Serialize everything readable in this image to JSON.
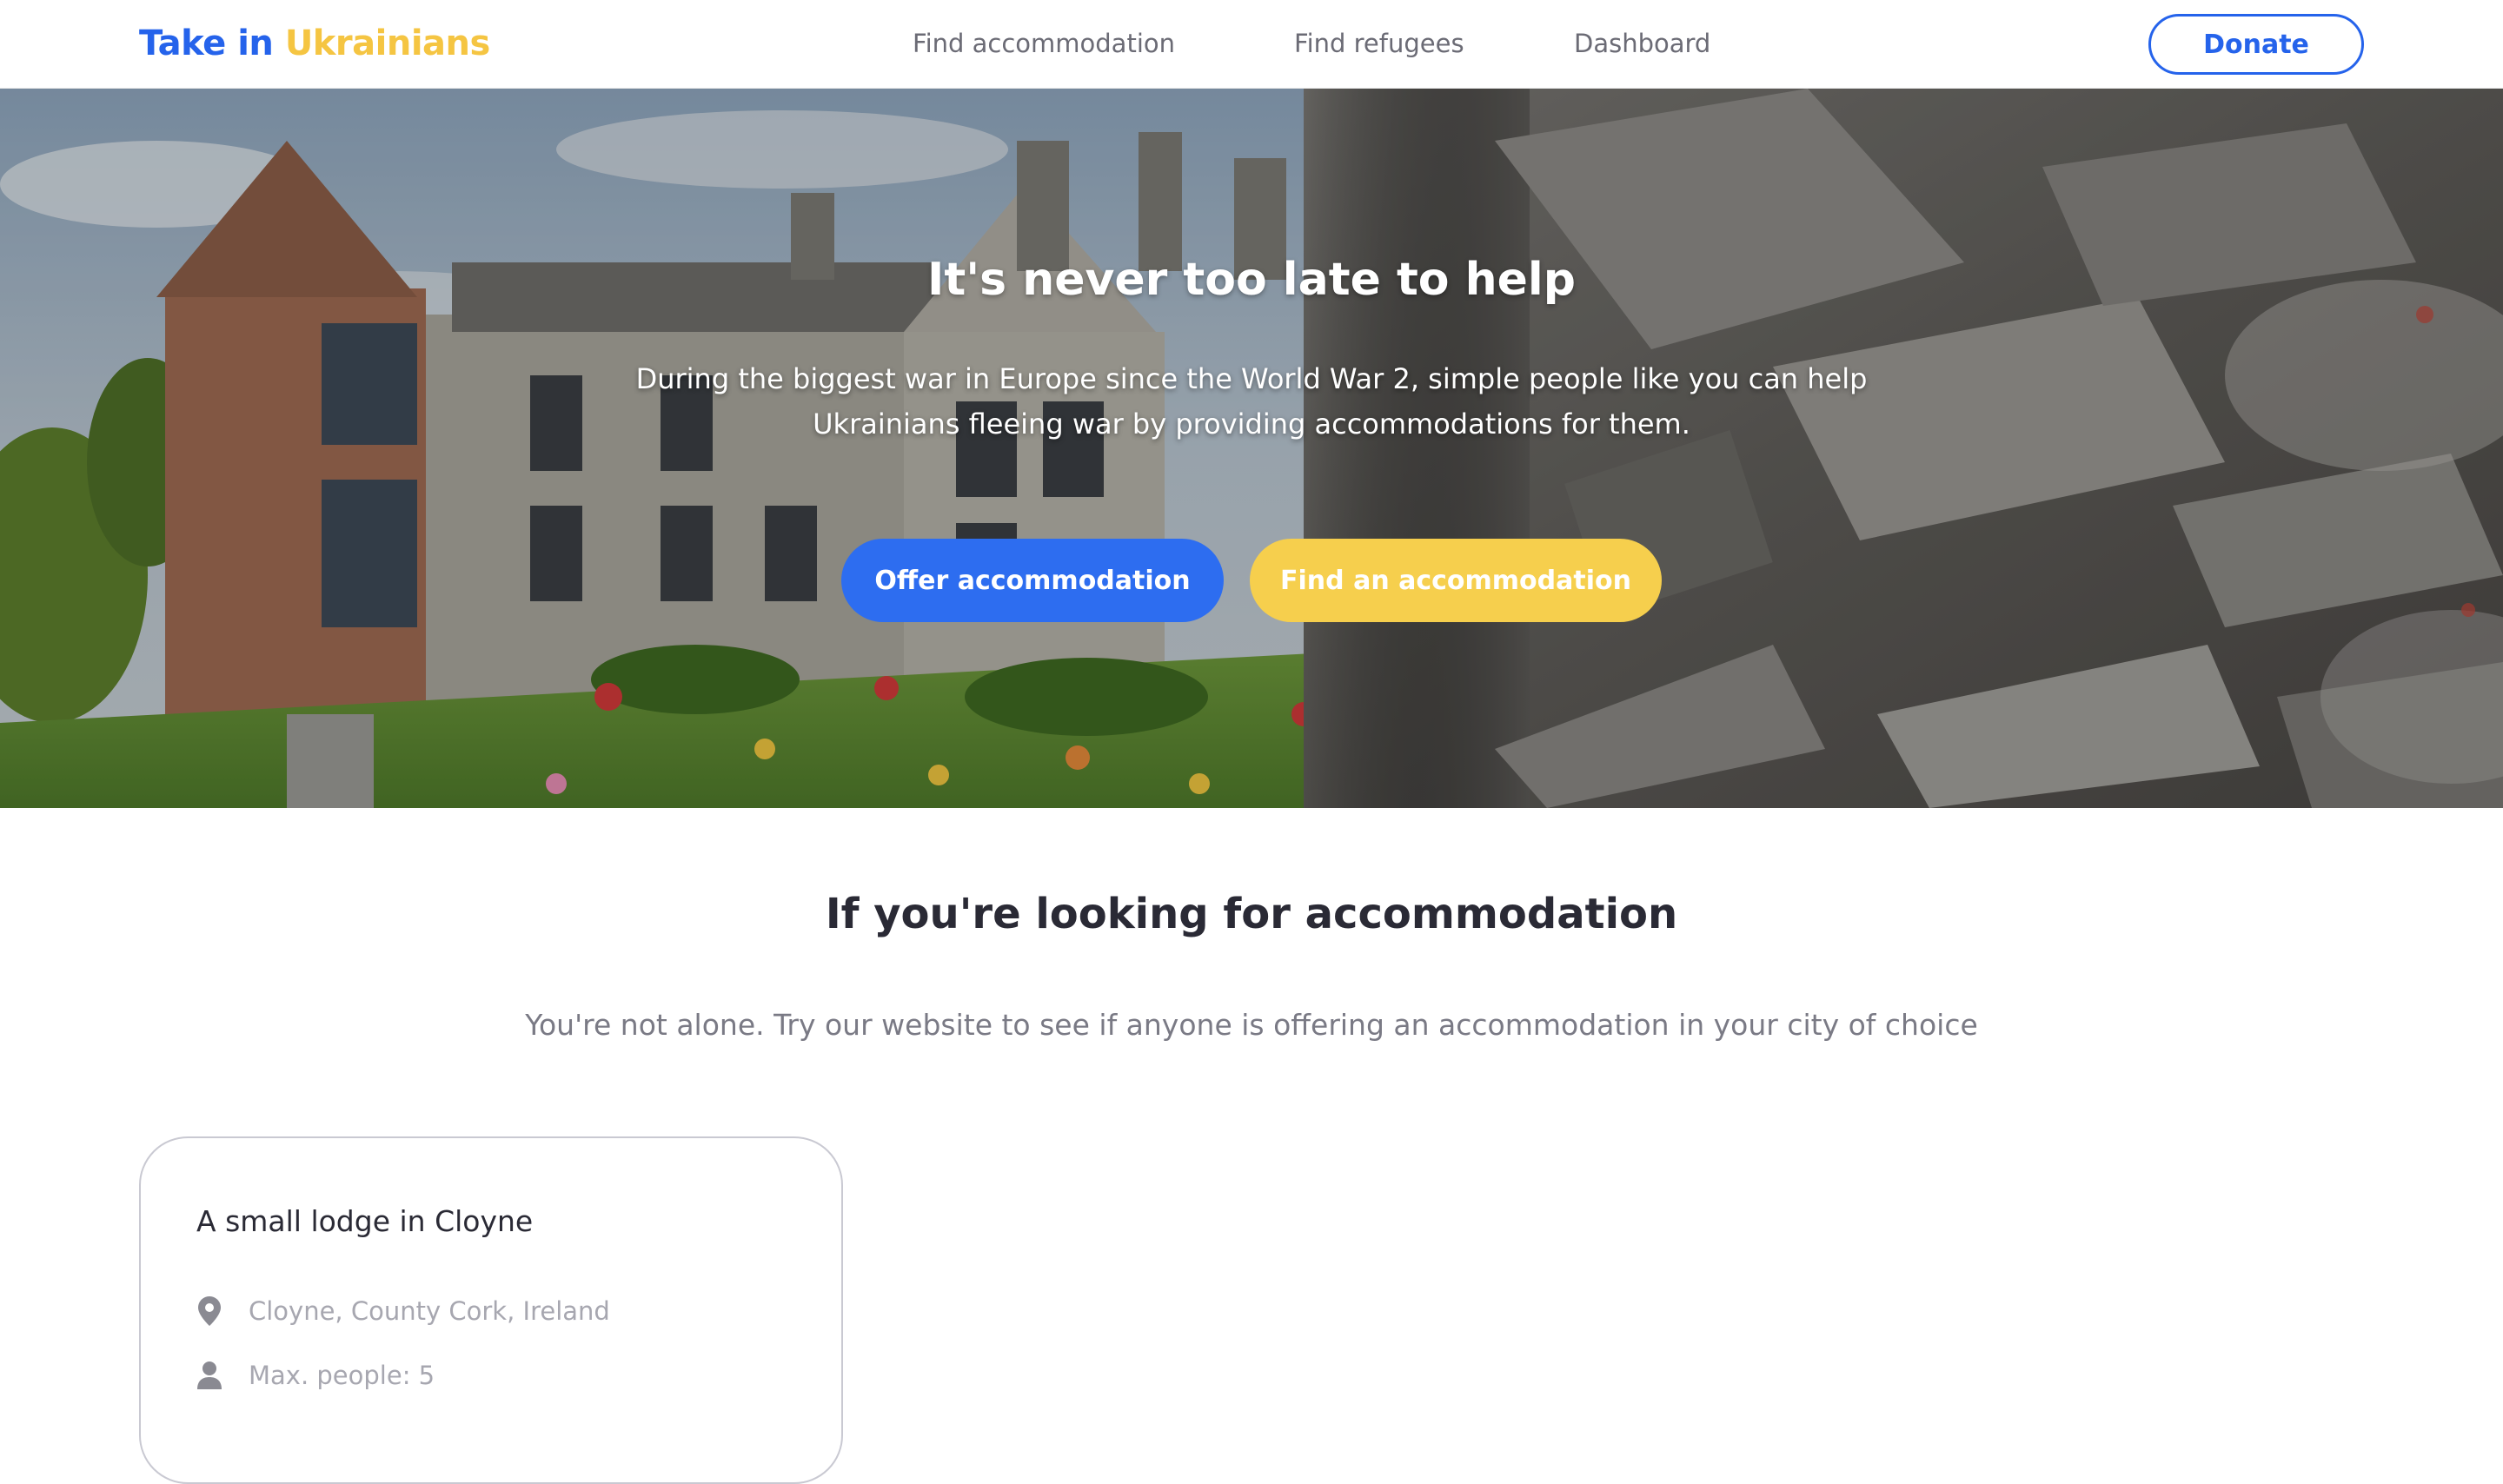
{
  "header": {
    "logo_part1": "Take in",
    "logo_part2": "Ukrainians",
    "nav": [
      "Find accommodation",
      "Find refugees",
      "Dashboard"
    ],
    "donate_label": "Donate"
  },
  "hero": {
    "title": "It's never too late to help",
    "subtitle": "During the biggest war in Europe since the World War 2, simple people like you can help Ukrainians fleeing war by providing accommodations for them.",
    "offer_label": "Offer accommodation",
    "find_label": "Find an accommodation"
  },
  "section": {
    "title": "If you're looking for accommodation",
    "subtitle": "You're not alone. Try our website to see if anyone is offering an accommodation in your city of choice"
  },
  "listing": {
    "title": "A small lodge in Cloyne",
    "location": "Cloyne, County Cork, Ireland",
    "max_people": "Max. people: 5",
    "location_icon": "map-pin-icon",
    "people_icon": "user-icon"
  },
  "colors": {
    "brand_blue": "#2563eb",
    "brand_yellow": "#f5c542"
  }
}
